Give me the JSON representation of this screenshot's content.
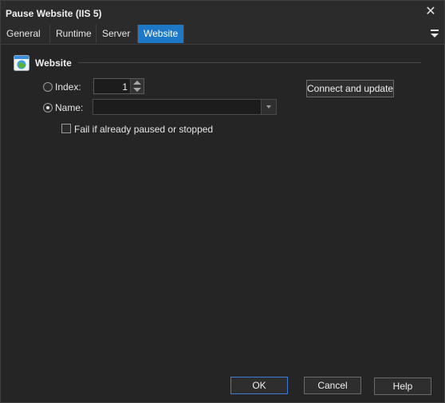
{
  "window": {
    "title": "Pause Website (IIS 5)"
  },
  "tabs": [
    {
      "label": "General"
    },
    {
      "label": "Runtime"
    },
    {
      "label": "Server"
    },
    {
      "label": "Website",
      "active": true
    }
  ],
  "section": {
    "title": "Website"
  },
  "form": {
    "index_label": "Index:",
    "index_value": "1",
    "name_label": "Name:",
    "name_value": "",
    "selected_option": "name",
    "fail_checkbox_label": "Fail if already paused or stopped",
    "fail_checkbox_checked": false,
    "connect_button": "Connect and update"
  },
  "footer": {
    "ok": "OK",
    "cancel": "Cancel",
    "help": "Help"
  },
  "colors": {
    "accent": "#1e78c8",
    "background": "#252525",
    "text": "#e6e6e6"
  },
  "icons": {
    "close": "close-icon",
    "menu": "menu-icon",
    "section": "website-icon"
  }
}
